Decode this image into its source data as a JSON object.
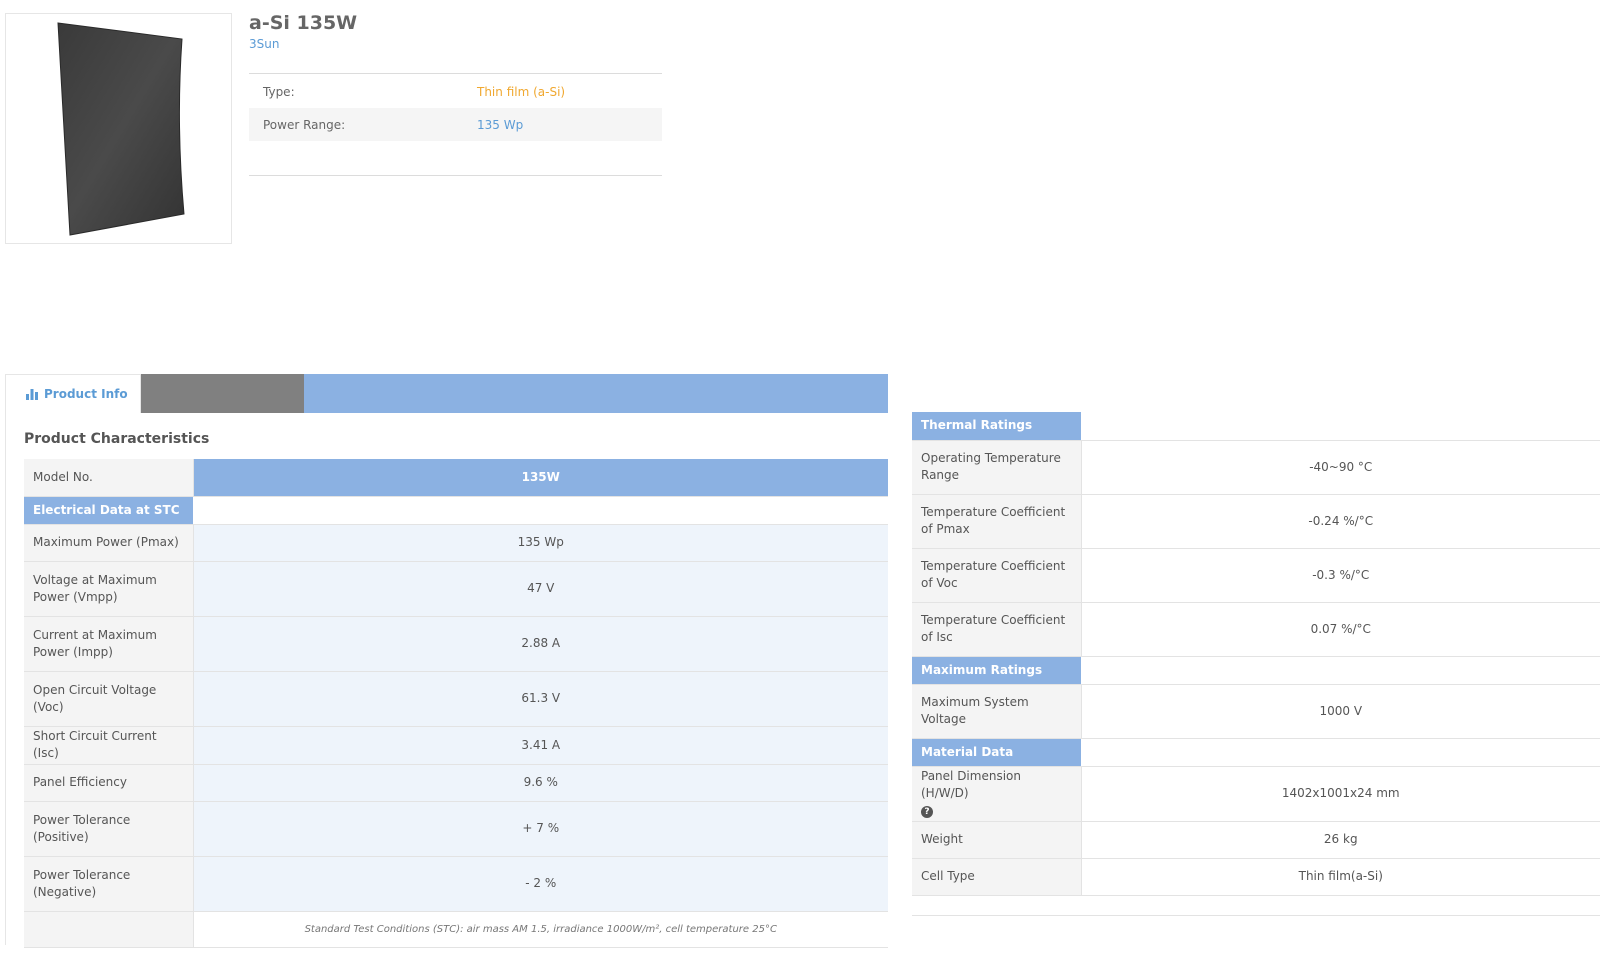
{
  "product": {
    "title": "a-Si 135W",
    "brand": "3Sun",
    "summary": [
      {
        "label": "Type:",
        "value": "Thin film (a-Si)"
      },
      {
        "label": "Power Range:",
        "value": "135 Wp"
      }
    ]
  },
  "tabs": {
    "active_label": "Product Info",
    "icon": "bar-chart-icon"
  },
  "characteristics": {
    "title": "Product Characteristics",
    "model_label": "Model No.",
    "model_value": "135W",
    "electrical_header": "Electrical Data at STC",
    "electrical_rows": [
      {
        "label": "Maximum Power (Pmax)",
        "value": "135 Wp"
      },
      {
        "label": "Voltage at Maximum Power (Vmpp)",
        "value": "47 V"
      },
      {
        "label": "Current at Maximum Power (Impp)",
        "value": "2.88 A"
      },
      {
        "label": "Open Circuit Voltage (Voc)",
        "value": "61.3 V"
      },
      {
        "label": "Short Circuit Current (Isc)",
        "value": "3.41 A"
      },
      {
        "label": "Panel Efficiency",
        "value": "9.6 %"
      },
      {
        "label": "Power Tolerance (Positive)",
        "value": "+ 7 %"
      },
      {
        "label": "Power Tolerance (Negative)",
        "value": "- 2 %"
      }
    ],
    "stc_note": "Standard Test Conditions (STC): air mass AM 1.5, irradiance 1000W/m², cell temperature 25°C"
  },
  "thermal": {
    "header": "Thermal Ratings",
    "rows": [
      {
        "label": "Operating Temperature Range",
        "value": "-40~90 °C"
      },
      {
        "label": "Temperature Coefficient of Pmax",
        "value": "-0.24 %/°C"
      },
      {
        "label": "Temperature Coefficient of Voc",
        "value": "-0.3 %/°C"
      },
      {
        "label": "Temperature Coefficient of Isc",
        "value": "0.07 %/°C"
      }
    ]
  },
  "maximum": {
    "header": "Maximum Ratings",
    "rows": [
      {
        "label": "Maximum System Voltage",
        "value": "1000 V"
      }
    ]
  },
  "material": {
    "header": "Material Data",
    "dimension_label": "Panel Dimension (H/W/D)",
    "dimension_help_icon": "question-circle-icon",
    "dimension_help_glyph": "?",
    "dimension_value": "1402x1001x24 mm",
    "rows": [
      {
        "label": "Weight",
        "value": "26 kg"
      },
      {
        "label": "Cell Type",
        "value": "Thin film(a-Si)"
      }
    ]
  }
}
